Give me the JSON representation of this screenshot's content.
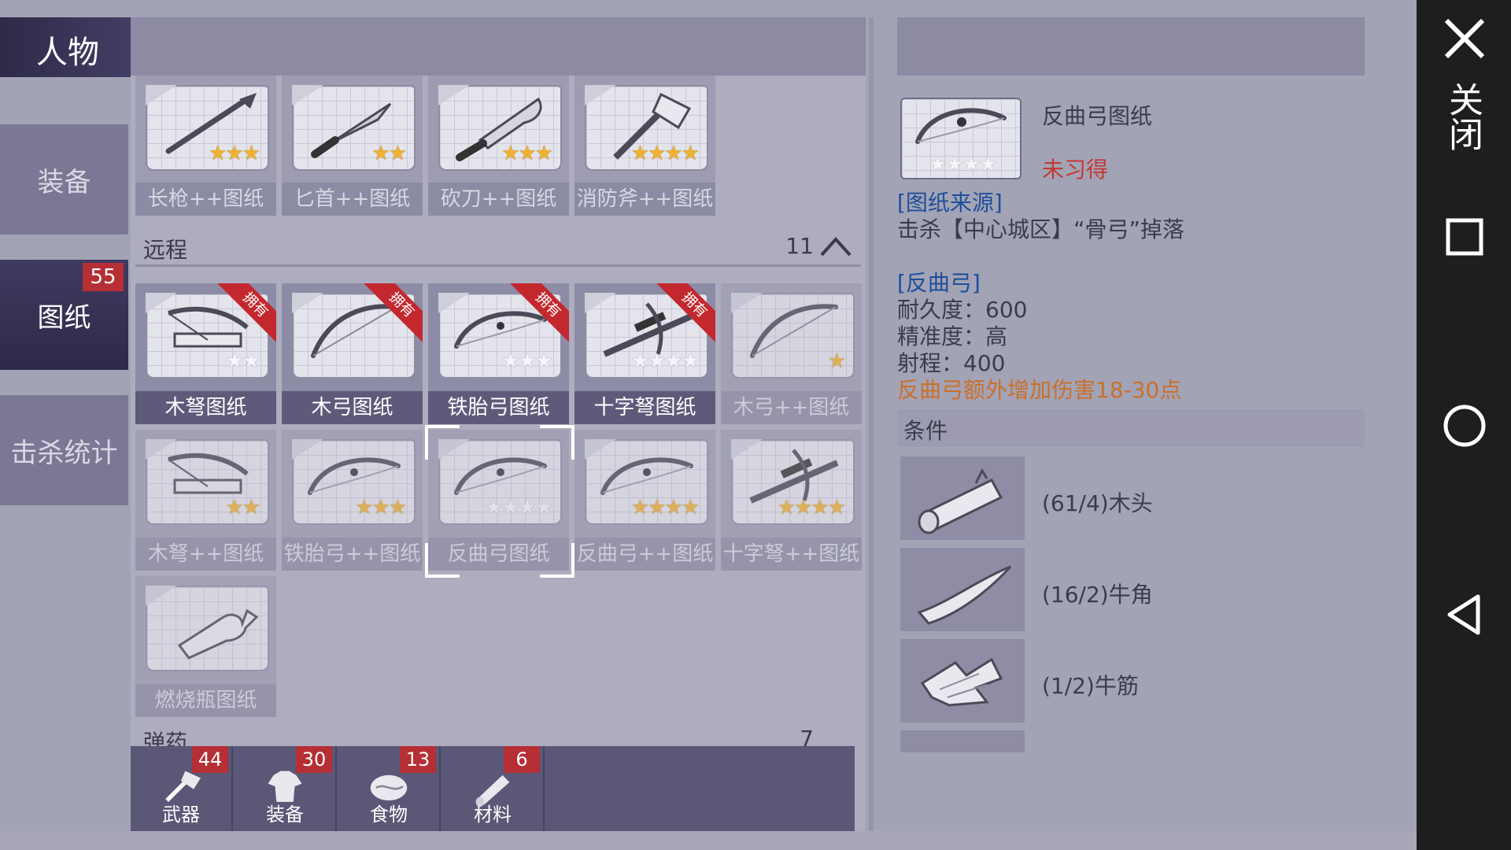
{
  "title": "人物",
  "tabs": [
    {
      "label": "装备",
      "active": false
    },
    {
      "label": "图纸",
      "active": true,
      "badge": "55"
    },
    {
      "label": "击杀统计",
      "active": false
    }
  ],
  "melee_row": [
    {
      "name": "长枪++图纸",
      "stars": 3,
      "max": 3,
      "icon": "spear-icon"
    },
    {
      "name": "匕首++图纸",
      "stars": 2,
      "max": 2,
      "icon": "dagger-icon"
    },
    {
      "name": "砍刀++图纸",
      "stars": 3,
      "max": 3,
      "icon": "machete-icon"
    },
    {
      "name": "消防斧++图纸",
      "stars": 4,
      "max": 4,
      "icon": "fire-axe-icon"
    }
  ],
  "ranged_section": {
    "label": "远程",
    "count": "11"
  },
  "ranged_cards": [
    {
      "name": "木弩图纸",
      "stars": 0,
      "max": 2,
      "owned": true,
      "icon": "crossbow-icon"
    },
    {
      "name": "木弓图纸",
      "stars": 0,
      "max": 0,
      "owned": true,
      "icon": "bow-icon"
    },
    {
      "name": "铁胎弓图纸",
      "stars": 0,
      "max": 3,
      "owned": true,
      "icon": "recurve-bow-icon"
    },
    {
      "name": "十字弩图纸",
      "stars": 0,
      "max": 4,
      "owned": true,
      "icon": "scope-crossbow-icon"
    },
    {
      "name": "木弓++图纸",
      "stars": 1,
      "max": 1,
      "owned": false,
      "icon": "bow-icon"
    },
    {
      "name": "木弩++图纸",
      "stars": 2,
      "max": 2,
      "owned": false,
      "icon": "crossbow-icon"
    },
    {
      "name": "铁胎弓++图纸",
      "stars": 3,
      "max": 3,
      "owned": false,
      "icon": "recurve-bow-icon"
    },
    {
      "name": "反曲弓图纸",
      "stars": 0,
      "max": 4,
      "owned": false,
      "selected": true,
      "icon": "recurve-bow-icon"
    },
    {
      "name": "反曲弓++图纸",
      "stars": 4,
      "max": 4,
      "owned": false,
      "icon": "recurve-bow-icon"
    },
    {
      "name": "十字弩++图纸",
      "stars": 4,
      "max": 4,
      "owned": false,
      "icon": "scope-crossbow-icon"
    },
    {
      "name": "燃烧瓶图纸",
      "stars": 0,
      "max": 0,
      "owned": false,
      "icon": "molotov-icon"
    }
  ],
  "owned_ribbon": "拥有",
  "ammo_section": {
    "label": "弹药",
    "count": "7"
  },
  "bottom_bar": [
    {
      "label": "武器",
      "badge": "44",
      "icon": "axe-icon"
    },
    {
      "label": "装备",
      "badge": "30",
      "icon": "shirt-icon"
    },
    {
      "label": "食物",
      "badge": "13",
      "icon": "meat-icon"
    },
    {
      "label": "材料",
      "badge": "6",
      "icon": "wood-icon"
    }
  ],
  "detail": {
    "name": "反曲弓图纸",
    "status": "未习得",
    "source_heading": "[图纸来源]",
    "source_text": "击杀【中心城区】“骨弓”掉落",
    "item_heading": "[反曲弓]",
    "durability": "耐久度：600",
    "accuracy": "精准度：高",
    "range": "射程：400",
    "bonus": "反曲弓额外增加伤害18-30点",
    "stars": 0,
    "max": 4,
    "conditions_label": "条件",
    "materials": [
      {
        "text": "(61/4)木头",
        "ok": true,
        "icon": "log-icon"
      },
      {
        "text": "(16/2)牛角",
        "ok": true,
        "icon": "horn-icon"
      },
      {
        "text": "(1/2)牛筋",
        "ok": false,
        "icon": "sinew-icon"
      }
    ]
  },
  "nav": {
    "close_label": "关闭"
  },
  "colors": {
    "owned_ribbon": "#c3282e",
    "badge": "#b52f35",
    "bonus_text": "#c9702a",
    "missing_text": "#c23a30",
    "link": "#1d4f9a"
  }
}
